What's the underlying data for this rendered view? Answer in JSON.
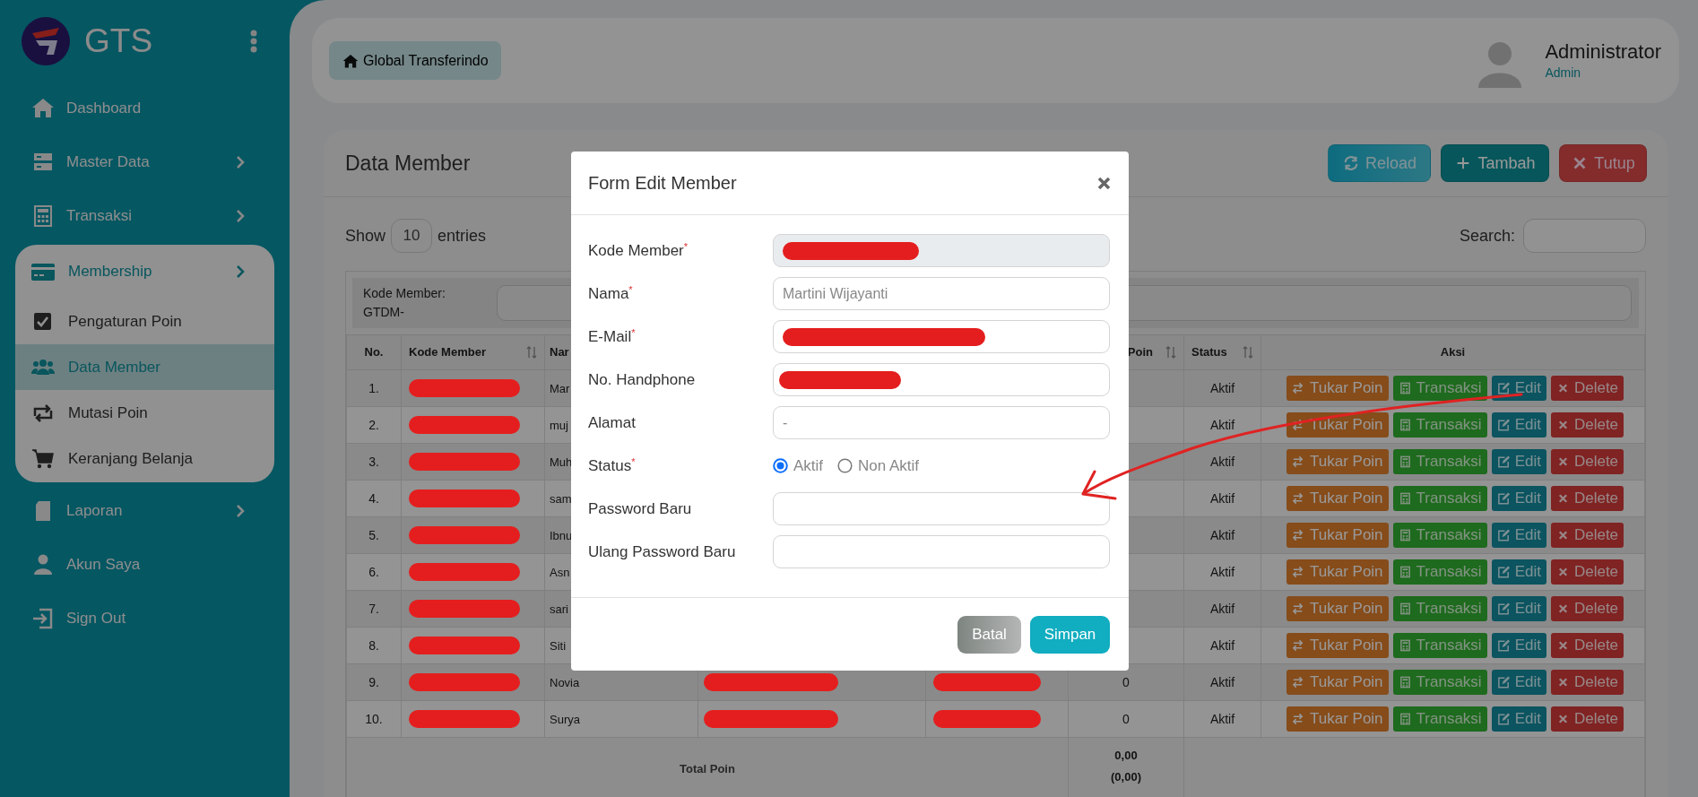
{
  "sidebar": {
    "brand": "GTS",
    "items": [
      {
        "label": "Dashboard",
        "kind": "link",
        "has_submenu": false,
        "selected": false
      },
      {
        "label": "Master Data",
        "kind": "link",
        "has_submenu": true,
        "selected": false
      },
      {
        "label": "Transaksi",
        "kind": "link",
        "has_submenu": true,
        "selected": false
      },
      {
        "label": "Membership",
        "kind": "group",
        "has_submenu": true,
        "expanded": true,
        "selected": false,
        "children": [
          {
            "label": "Pengaturan Poin",
            "selected": false
          },
          {
            "label": "Data Member",
            "selected": true
          },
          {
            "label": "Mutasi Poin",
            "selected": false
          },
          {
            "label": "Keranjang Belanja",
            "selected": false
          }
        ]
      },
      {
        "label": "Laporan",
        "kind": "link",
        "has_submenu": true,
        "selected": false
      },
      {
        "label": "Akun Saya",
        "kind": "link",
        "has_submenu": false,
        "selected": false
      },
      {
        "label": "Sign Out",
        "kind": "link",
        "has_submenu": false,
        "selected": false
      }
    ]
  },
  "header": {
    "home_button": "Global Transferindo",
    "user": {
      "name": "Administrator",
      "role": "Admin"
    }
  },
  "content": {
    "title": "Data Member",
    "buttons": [
      {
        "label": "Reload",
        "kind": "reload"
      },
      {
        "label": "Tambah",
        "kind": "add"
      },
      {
        "label": "Tutup",
        "kind": "close"
      }
    ],
    "show_entries": {
      "before": "Show",
      "value": "10",
      "after": "entries"
    },
    "search_label": "Search:",
    "filter_label": "Kode Member: GTDM-",
    "table": {
      "columns": [
        {
          "label": "No.",
          "sortable": false
        },
        {
          "label": "Kode Member",
          "sortable": true
        },
        {
          "label": "Nar"
        },
        {
          "label": "Poin",
          "sortable": true
        },
        {
          "label": "Status",
          "sortable": true
        },
        {
          "label": "Aksi",
          "sortable": false
        }
      ],
      "rows": [
        {
          "no": "1.",
          "kode_redacted": true,
          "nama": "Mar",
          "status": "Aktif",
          "actions": [
            "Tukar Poin",
            "Transaksi",
            "Edit",
            "Delete"
          ]
        },
        {
          "no": "2.",
          "kode_redacted": true,
          "nama": "muj",
          "status": "Aktif",
          "actions": [
            "Tukar Poin",
            "Transaksi",
            "Edit",
            "Delete"
          ]
        },
        {
          "no": "3.",
          "kode_redacted": true,
          "nama": "Muh",
          "status": "Aktif",
          "actions": [
            "Tukar Poin",
            "Transaksi",
            "Edit",
            "Delete"
          ]
        },
        {
          "no": "4.",
          "kode_redacted": true,
          "nama": "sam",
          "status": "Aktif",
          "actions": [
            "Tukar Poin",
            "Transaksi",
            "Edit",
            "Delete"
          ]
        },
        {
          "no": "5.",
          "kode_redacted": true,
          "nama": "Ibnu",
          "status": "Aktif",
          "actions": [
            "Tukar Poin",
            "Transaksi",
            "Edit",
            "Delete"
          ]
        },
        {
          "no": "6.",
          "kode_redacted": true,
          "nama": "Asn",
          "status": "Aktif",
          "actions": [
            "Tukar Poin",
            "Transaksi",
            "Edit",
            "Delete"
          ]
        },
        {
          "no": "7.",
          "kode_redacted": true,
          "nama": "sari",
          "status": "Aktif",
          "actions": [
            "Tukar Poin",
            "Transaksi",
            "Edit",
            "Delete"
          ]
        },
        {
          "no": "8.",
          "kode_redacted": true,
          "nama": "Siti",
          "status": "Aktif",
          "actions": [
            "Tukar Poin",
            "Transaksi",
            "Edit",
            "Delete"
          ]
        },
        {
          "no": "9.",
          "kode_redacted": true,
          "nama": "Novia",
          "column_4_redacted": true,
          "column_5_redacted": true,
          "poin": "0",
          "status": "Aktif",
          "actions": [
            "Tukar Poin",
            "Transaksi",
            "Edit",
            "Delete"
          ]
        },
        {
          "no": "10.",
          "kode_redacted": true,
          "nama": "Surya",
          "column_4_redacted": true,
          "column_5_redacted": true,
          "poin": "0",
          "status": "Aktif",
          "actions": [
            "Tukar Poin",
            "Transaksi",
            "Edit",
            "Delete"
          ]
        }
      ],
      "total": {
        "label": "Total Poin",
        "value": "0,00",
        "sub_value": "(0,00)"
      }
    }
  },
  "dialog": {
    "title": "Form Edit Member",
    "fields": [
      {
        "label": "Kode Member$^{*}$",
        "kind": "text",
        "readonly": true,
        "redacted": true
      },
      {
        "label": "Nama$^{*}$",
        "kind": "text",
        "readonly": false,
        "value": "Martini Wijayanti"
      },
      {
        "label": "E-Mail$^{*}$",
        "kind": "text",
        "readonly": false,
        "redacted": true
      },
      {
        "label": "No. Handphone",
        "kind": "text",
        "readonly": false,
        "redacted": true
      },
      {
        "label": "Alamat",
        "kind": "text",
        "readonly": false,
        "value": "-"
      },
      {
        "label": "Status$^{*}$",
        "kind": "radio",
        "options": [
          {
            "label": "Aktif",
            "selected": true
          },
          {
            "label": "Non Aktif",
            "selected": false
          }
        ]
      },
      {
        "label": "Password Baru",
        "kind": "password",
        "readonly": false
      },
      {
        "label": "Ulang Password Baru",
        "kind": "password",
        "readonly": false
      }
    ],
    "buttons": [
      {
        "label": "Batal",
        "kind": "cancel"
      },
      {
        "label": "Simpan",
        "kind": "save"
      }
    ]
  }
}
